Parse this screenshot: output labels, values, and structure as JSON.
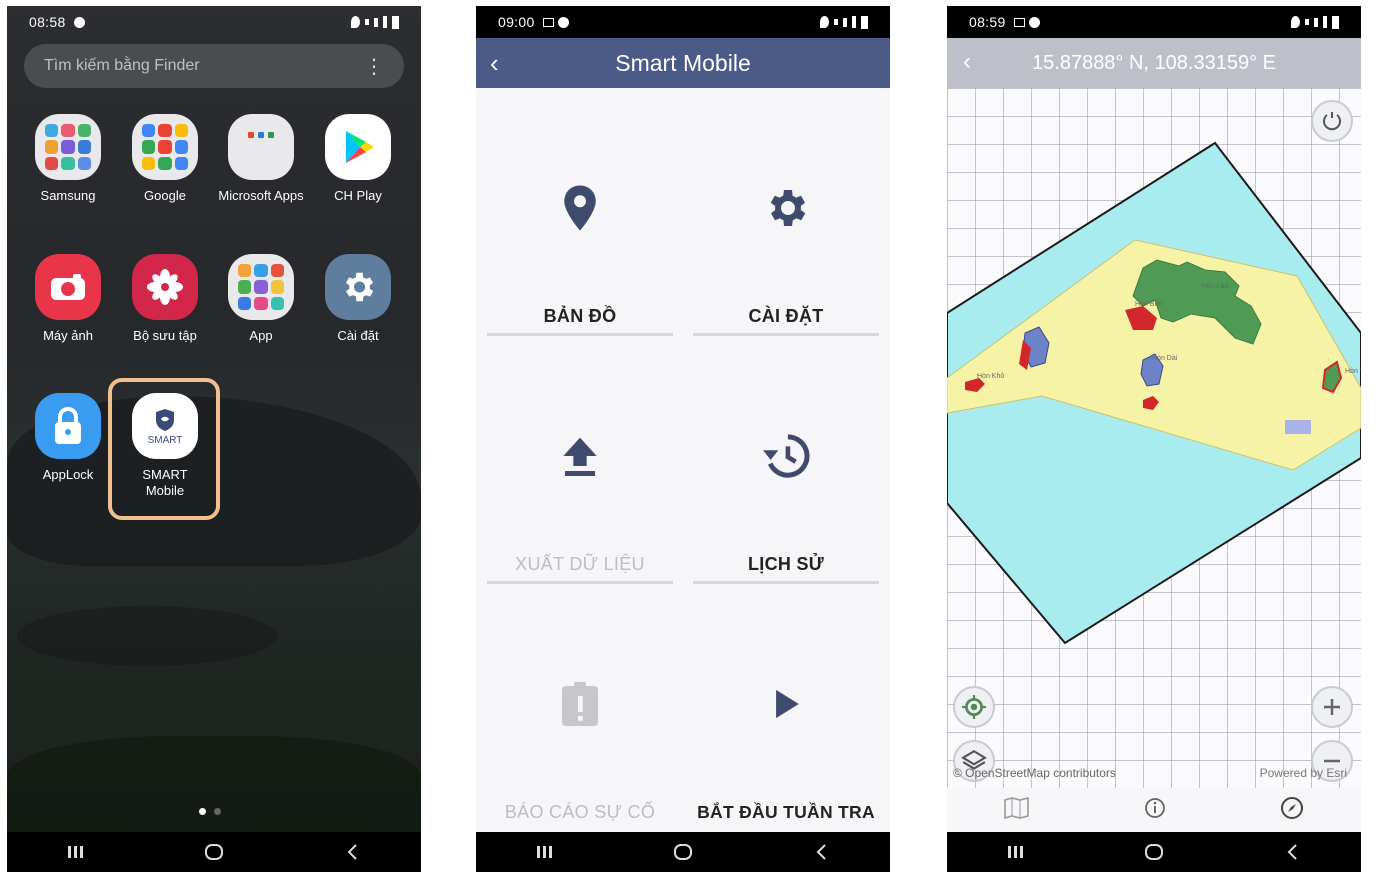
{
  "screen1": {
    "status": {
      "time": "08:58"
    },
    "search": {
      "placeholder": "Tìm kiếm bằng Finder",
      "more": "⋮"
    },
    "apps": [
      {
        "label": "Samsung"
      },
      {
        "label": "Google"
      },
      {
        "label": "Microsoft Apps"
      },
      {
        "label": "CH Play"
      },
      {
        "label": "Máy ảnh"
      },
      {
        "label": "Bộ sưu tập"
      },
      {
        "label": "App"
      },
      {
        "label": "Cài đặt"
      },
      {
        "label": "AppLock"
      },
      {
        "label": "SMART Mobile",
        "icon_text": "SMART"
      }
    ],
    "highlight_color": "#f0c08e"
  },
  "screen2": {
    "status": {
      "time": "09:00"
    },
    "title": "Smart Mobile",
    "accent": "#4b5a86",
    "tiles": [
      {
        "label": "BẢN ĐỒ",
        "icon": "map-pin-icon",
        "enabled": true
      },
      {
        "label": "CÀI ĐẶT",
        "icon": "gear-icon",
        "enabled": true
      },
      {
        "label": "XUẤT DỮ LIỆU",
        "icon": "upload-icon",
        "enabled": false
      },
      {
        "label": "LỊCH SỬ",
        "icon": "history-icon",
        "enabled": true
      },
      {
        "label": "BÁO CÁO SỰ CỐ",
        "icon": "report-icon",
        "enabled": false
      },
      {
        "label": "BẮT ĐẦU TUẦN TRA",
        "icon": "play-icon",
        "enabled": true
      }
    ]
  },
  "screen3": {
    "status": {
      "time": "08:59"
    },
    "coords": "15.87888° N, 108.33159° E",
    "attribution": "© OpenStreetMap contributors",
    "powered": "Powered by Esri",
    "map_colors": {
      "water": "#a9ecf0",
      "zone": "#f7f3a6",
      "land": "#4f9a55",
      "marker": "#d3282b"
    }
  }
}
